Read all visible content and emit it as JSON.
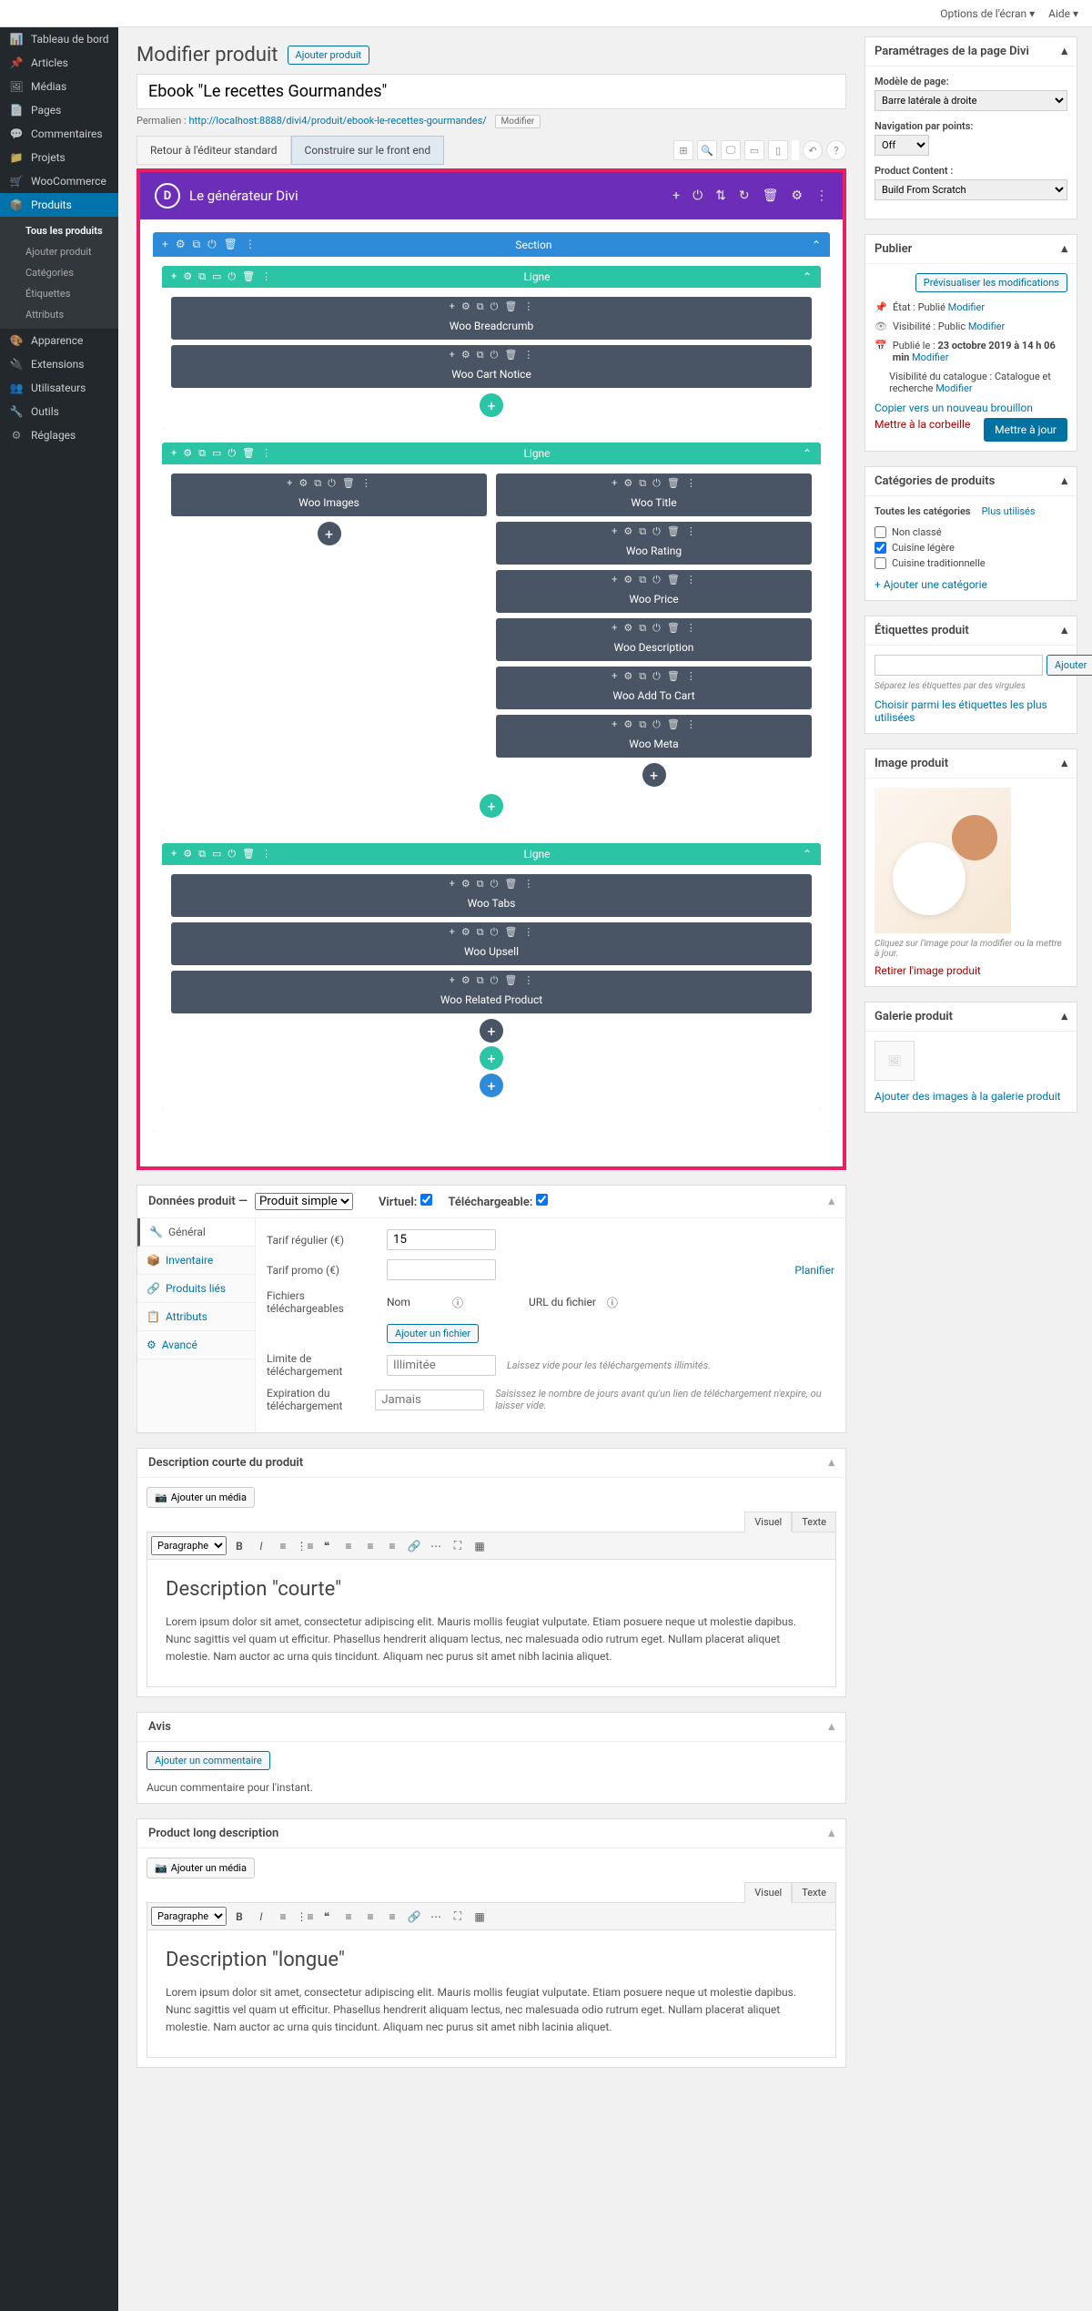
{
  "topbar": {
    "screen_options": "Options de l'écran ▾",
    "help": "Aide ▾"
  },
  "sidebar": {
    "items": [
      {
        "icon": "📊",
        "label": "Tableau de bord"
      },
      {
        "icon": "📌",
        "label": "Articles"
      },
      {
        "icon": "🖼",
        "label": "Médias"
      },
      {
        "icon": "📄",
        "label": "Pages"
      },
      {
        "icon": "💬",
        "label": "Commentaires"
      },
      {
        "icon": "📁",
        "label": "Projets"
      },
      {
        "icon": "🛒",
        "label": "WooCommerce"
      },
      {
        "icon": "📦",
        "label": "Produits",
        "active": true
      },
      {
        "icon": "🎨",
        "label": "Apparence"
      },
      {
        "icon": "🔌",
        "label": "Extensions"
      },
      {
        "icon": "👥",
        "label": "Utilisateurs"
      },
      {
        "icon": "🔧",
        "label": "Outils"
      },
      {
        "icon": "⚙",
        "label": "Réglages"
      }
    ],
    "sub": [
      {
        "label": "Tous les produits",
        "sel": true
      },
      {
        "label": "Ajouter produit"
      },
      {
        "label": "Catégories"
      },
      {
        "label": "Étiquettes"
      },
      {
        "label": "Attributs"
      }
    ]
  },
  "page": {
    "title": "Modifier produit",
    "add_new": "Ajouter produit"
  },
  "product_title": "Ebook \"Le recettes Gourmandes\"",
  "permalink": {
    "label": "Permalien :",
    "url": "http://localhost:8888/divi4/produit/ebook-le-recettes-gourmandes/",
    "edit": "Modifier"
  },
  "editor_tabs": {
    "default": "Retour à l'éditeur standard",
    "frontend": "Construire sur le front end"
  },
  "divi": {
    "title": "Le générateur Divi",
    "section": "Section",
    "row": "Ligne",
    "modules": {
      "breadcrumb": "Woo Breadcrumb",
      "cart_notice": "Woo Cart Notice",
      "images": "Woo Images",
      "title": "Woo Title",
      "rating": "Woo Rating",
      "price": "Woo Price",
      "description": "Woo Description",
      "add_to_cart": "Woo Add To Cart",
      "meta": "Woo Meta",
      "tabs": "Woo Tabs",
      "upsell": "Woo Upsell",
      "related": "Woo Related Product"
    }
  },
  "product_data": {
    "title": "Données produit —",
    "type": "Produit simple",
    "virtual": "Virtuel:",
    "downloadable": "Téléchargeable:",
    "tabs": {
      "general": "Général",
      "inventory": "Inventaire",
      "linked": "Produits liés",
      "attributes": "Attributs",
      "advanced": "Avancé"
    },
    "regular_price": "Tarif régulier (€)",
    "regular_value": "15",
    "sale_price": "Tarif promo (€)",
    "schedule": "Planifier",
    "files": "Fichiers téléchargeables",
    "name_col": "Nom",
    "url_col": "URL du fichier",
    "add_file": "Ajouter un fichier",
    "dl_limit": "Limite de téléchargement",
    "dl_limit_val": "Illimitée",
    "dl_limit_help": "Laissez vide pour les téléchargements illimités.",
    "dl_expiry": "Expiration du téléchargement",
    "dl_expiry_val": "Jamais",
    "dl_expiry_help": "Saisissez le nombre de jours avant qu'un lien de téléchargement n'expire, ou laisser vide."
  },
  "short_desc": {
    "title": "Description courte du produit",
    "add_media": "Ajouter un média",
    "visual": "Visuel",
    "text": "Texte",
    "paragraph": "Paragraphe",
    "heading": "Description \"courte\"",
    "body": "Lorem ipsum dolor sit amet, consectetur adipiscing elit. Mauris mollis feugiat vulputate. Etiam posuere neque ut molestie dapibus. Nunc sagittis vel quam ut efficitur. Phasellus hendrerit aliquam lectus, nec malesuada odio rutrum eget. Nullam placerat aliquet molestie. Nam auctor ac urna quis tincidunt. Aliquam nec purus sit amet nibh lacinia aliquet."
  },
  "reviews": {
    "title": "Avis",
    "add": "Ajouter un commentaire",
    "none": "Aucun commentaire pour l'instant."
  },
  "long_desc": {
    "title": "Product long description",
    "heading": "Description \"longue\"",
    "body": "Lorem ipsum dolor sit amet, consectetur adipiscing elit. Mauris mollis feugiat vulputate. Etiam posuere neque ut molestie dapibus. Nunc sagittis vel quam ut efficitur. Phasellus hendrerit aliquam lectus, nec malesuada odio rutrum eget. Nullam placerat aliquet molestie. Nam auctor ac urna quis tincidunt. Aliquam nec purus sit amet nibh lacinia aliquet."
  },
  "divi_settings": {
    "title": "Paramétrages de la page Divi",
    "template_label": "Modèle de page:",
    "template": "Barre latérale à droite",
    "dotnav_label": "Navigation par points:",
    "dotnav": "Off",
    "content_label": "Product Content :",
    "content": "Build From Scratch"
  },
  "publish": {
    "title": "Publier",
    "preview": "Prévisualiser les modifications",
    "status_label": "État :",
    "status": "Publié",
    "edit": "Modifier",
    "visibility_label": "Visibilité :",
    "visibility": "Public",
    "date_label": "Publié le :",
    "date": "23 octobre 2019 à 14 h 06 min",
    "catalog_label": "Visibilité du catalogue :",
    "catalog": "Catalogue et recherche",
    "copy_draft": "Copier vers un nouveau brouillon",
    "trash": "Mettre à la corbeille",
    "update": "Mettre à jour"
  },
  "categories": {
    "title": "Catégories de produits",
    "all": "Toutes les catégories",
    "most_used": "Plus utilisés",
    "items": [
      {
        "label": "Non classé",
        "checked": false
      },
      {
        "label": "Cuisine légère",
        "checked": true
      },
      {
        "label": "Cuisine traditionnelle",
        "checked": false
      }
    ],
    "add": "+ Ajouter une catégorie"
  },
  "tags": {
    "title": "Étiquettes produit",
    "add": "Ajouter",
    "help": "Séparez les étiquettes par des virgules",
    "choose": "Choisir parmi les étiquettes les plus utilisées"
  },
  "image": {
    "title": "Image produit",
    "click_help": "Cliquez sur l'image pour la modifier ou la mettre à jour.",
    "remove": "Retirer l'image produit"
  },
  "gallery": {
    "title": "Galerie produit",
    "add": "Ajouter des images à la galerie produit"
  }
}
